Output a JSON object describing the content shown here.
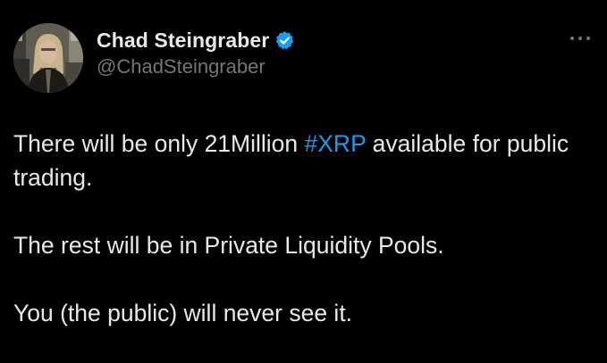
{
  "tweet": {
    "author": {
      "display_name": "Chad Steingraber",
      "handle": "@ChadSteingraber",
      "verified": true,
      "avatar_icon": "person-photo"
    },
    "more_icon": "more-options-icon",
    "text": {
      "para1_before": "There will be only 21Million ",
      "para1_hashtag": "#XRP",
      "para1_after": " available for public trading.",
      "para2": "The rest will be in Private Liquidity Pools.",
      "para3": "You (the public) will never see it."
    }
  },
  "colors": {
    "background": "#000000",
    "text_primary": "#e7e9ea",
    "text_secondary": "#71767b",
    "accent": "#1d9bf0"
  }
}
